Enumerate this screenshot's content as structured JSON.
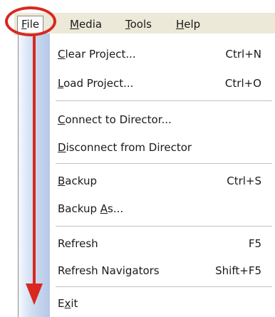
{
  "menubar": {
    "items": [
      {
        "pre": "",
        "key": "F",
        "post": "ile"
      },
      {
        "pre": "",
        "key": "M",
        "post": "edia"
      },
      {
        "pre": "",
        "key": "T",
        "post": "ools"
      },
      {
        "pre": "",
        "key": "H",
        "post": "elp"
      }
    ]
  },
  "file_menu": {
    "items": [
      {
        "pre": "",
        "key": "C",
        "post": "lear Project...",
        "shortcut": "Ctrl+N"
      },
      {
        "pre": "",
        "key": "L",
        "post": "oad Project...",
        "shortcut": "Ctrl+O"
      },
      {
        "pre": "",
        "key": "C",
        "post": "onnect to Director...",
        "shortcut": ""
      },
      {
        "pre": "",
        "key": "D",
        "post": "isconnect from Director",
        "shortcut": ""
      },
      {
        "pre": "",
        "key": "B",
        "post": "ackup",
        "shortcut": "Ctrl+S"
      },
      {
        "pre": "Backup ",
        "key": "A",
        "post": "s...",
        "shortcut": ""
      },
      {
        "pre": "Refresh",
        "key": "",
        "post": "",
        "shortcut": "F5"
      },
      {
        "pre": "Refresh Navigators",
        "key": "",
        "post": "",
        "shortcut": "Shift+F5"
      },
      {
        "pre": "E",
        "key": "x",
        "post": "it",
        "shortcut": ""
      }
    ]
  },
  "annotation": {
    "color": "#d8281f"
  }
}
